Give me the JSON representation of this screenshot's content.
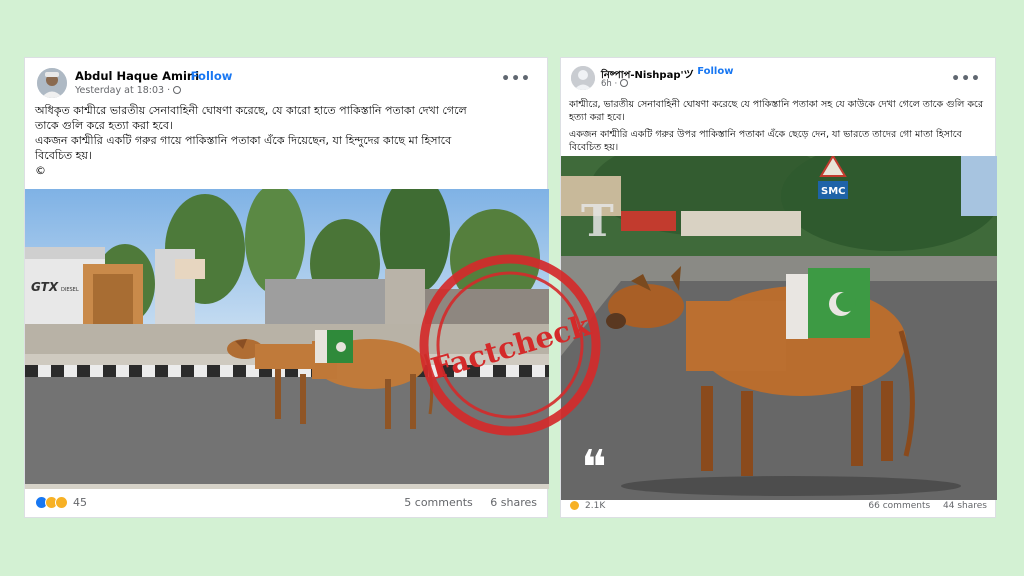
{
  "left_post": {
    "author": "Abdul Haque Amini",
    "follow_label": "Follow",
    "dot": "·",
    "meta": "Yesterday at 18:03 ·",
    "more_label": "•••",
    "text_lines": [
      "অধিকৃত কাশ্মীরে ভারতীয় সেনাবাহিনী ঘোষণা করেছে, যে কারো হাতে পাকিস্তানি পতাকা দেখা গেলে",
      "তাকে গুলি করে হত্যা করা হবে।",
      "একজন কাশ্মীরি একটি গরুর গায়ে পাকিস্তানি পতাকা এঁকে দিয়েছেন, যা হিন্দুদের কাছে মা হিসাবে",
      "বিবেচিত হয়।",
      "©"
    ],
    "image_sign": "GTX",
    "image_sign_sub": "DIESEL",
    "reactions_count": "45",
    "comments": "5 comments",
    "shares": "6 shares"
  },
  "right_post": {
    "author": "নিষ্পাপ-Nishpap'ツ",
    "follow_label": "Follow",
    "dot": "·",
    "meta": "6h ·",
    "more_label": "•••",
    "text_paragraphs": [
      "কাশ্মীরে, ভারতীয় সেনাবাহিনী ঘোষণা করেছে যে পাকিস্তানি পতাকা সহ যে কাউকে দেখা গেলে তাকে গুলি করে হত্যা করা হবে।",
      "একজন কাশ্মীরি একটি গরুর উপর পাকিস্তানি পতাকা এঁকে ছেড়ে দেন, যা ভারতে তাদের গো মাতা হিসাবে বিবেচিত হয়।"
    ],
    "image_sign": "SMC",
    "quote_glyph": "❝",
    "reactions_count": "2.1K",
    "comments": "66 comments",
    "shares": "44 shares"
  },
  "stamp": {
    "label": "Factcheck",
    "color": "#d42a2a"
  },
  "colors": {
    "background": "#d3f1d3",
    "accent": "#1877f2"
  }
}
